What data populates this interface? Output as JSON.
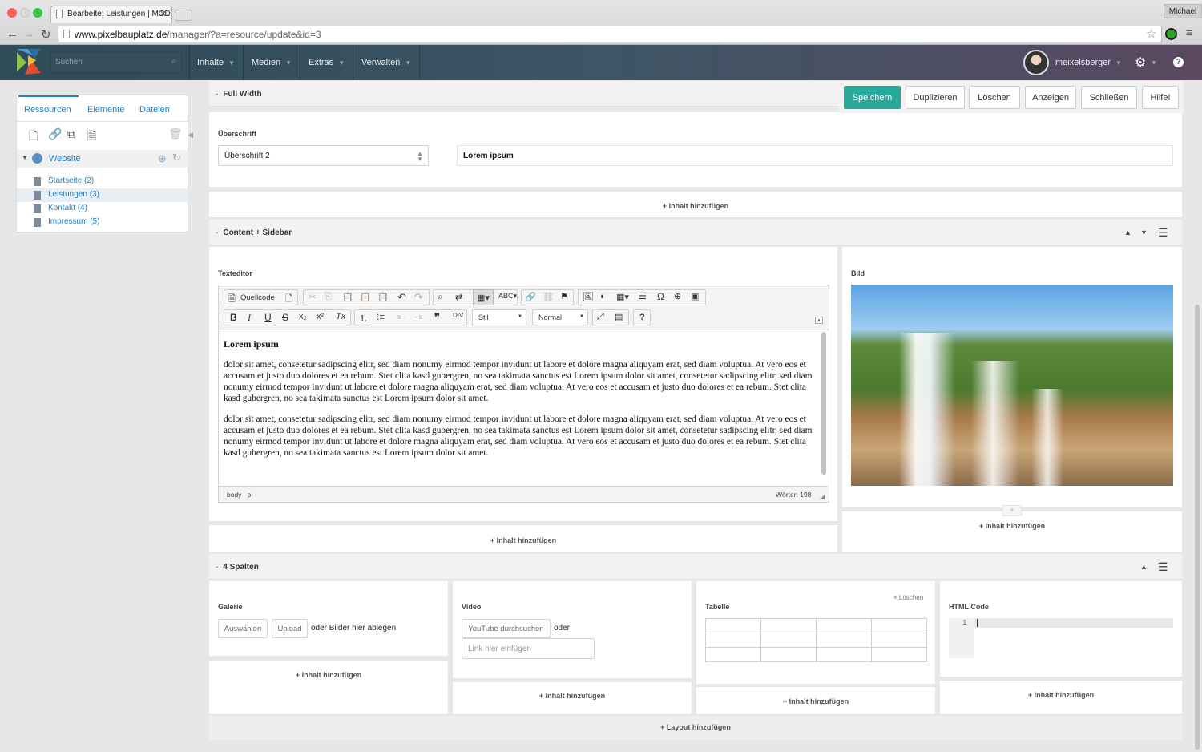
{
  "browser": {
    "tab_title": "Bearbeite: Leistungen | MODX",
    "window_user": "Michael",
    "url_domain": "www.pixelbauplatz.de",
    "url_path": "/manager/?a=resource/update&id=3"
  },
  "header": {
    "search_placeholder": "Suchen",
    "nav": [
      "Inhalte",
      "Medien",
      "Extras",
      "Verwalten"
    ],
    "username": "meixelsberger"
  },
  "sidebar": {
    "tabs": [
      "Ressourcen",
      "Elemente",
      "Dateien"
    ],
    "root": "Website",
    "items": [
      "Startseite (2)",
      "Leistungen (3)",
      "Kontakt (4)",
      "Impressum (5)"
    ]
  },
  "actions": [
    "Speichern",
    "Duplizieren",
    "Löschen",
    "Anzeigen",
    "Schließen",
    "Hilfe!"
  ],
  "section1": {
    "title": "Full Width",
    "heading_label": "Überschrift",
    "heading_select": "Überschrift 2",
    "heading_value": "Lorem ipsum",
    "add": "+ Inhalt hinzufügen"
  },
  "section2": {
    "title": "Content + Sidebar",
    "editor_label": "Texteditor",
    "source_button": "Quellcode",
    "style_select": "Stil",
    "format_select": "Normal",
    "editor_heading": "Lorem ipsum",
    "editor_paragraphs": [
      "dolor sit amet, consetetur sadipscing elitr, sed diam nonumy eirmod tempor invidunt ut labore et dolore magna aliquyam erat, sed diam voluptua. At vero eos et accusam et justo duo dolores et ea rebum. Stet clita kasd gubergren, no sea takimata sanctus est Lorem ipsum dolor sit amet, consetetur sadipscing elitr, sed diam nonumy eirmod tempor invidunt ut labore et dolore magna aliquyam erat, sed diam voluptua. At vero eos et accusam et justo duo dolores et ea rebum. Stet clita kasd gubergren, no sea takimata sanctus est Lorem ipsum dolor sit amet.",
      "dolor sit amet, consetetur sadipscing elitr, sed diam nonumy eirmod tempor invidunt ut labore et dolore magna aliquyam erat, sed diam voluptua. At vero eos et accusam et justo duo dolores et ea rebum. Stet clita kasd gubergren, no sea takimata sanctus est Lorem ipsum dolor sit amet, consetetur sadipscing elitr, sed diam nonumy eirmod tempor invidunt ut labore et dolore magna aliquyam erat, sed diam voluptua. At vero eos et accusam et justo duo dolores et ea rebum. Stet clita kasd gubergren, no sea takimata sanctus est Lorem ipsum dolor sit amet."
    ],
    "status_path": "body   p",
    "word_count": "Wörter: 198",
    "image_label": "Bild",
    "add": "+ Inhalt hinzufügen",
    "add_plus": "+"
  },
  "section3": {
    "title": "4 Spalten",
    "gallery_label": "Galerie",
    "select_button": "Auswählen",
    "upload_button": "Upload",
    "drop_text": "oder Bilder hier ablegen",
    "video_label": "Video",
    "youtube_button": "YouTube durchsuchen",
    "or_text": "oder",
    "link_placeholder": "Link hier einfügen",
    "table_label": "Tabelle",
    "table_delete": "× Löschen",
    "html_label": "HTML Code",
    "line_number": "1",
    "add": "+ Inhalt hinzufügen"
  },
  "footer_add": "+ Layout hinzufügen",
  "colors": {
    "primary": "#27a89a",
    "link": "#1f7fbf"
  }
}
